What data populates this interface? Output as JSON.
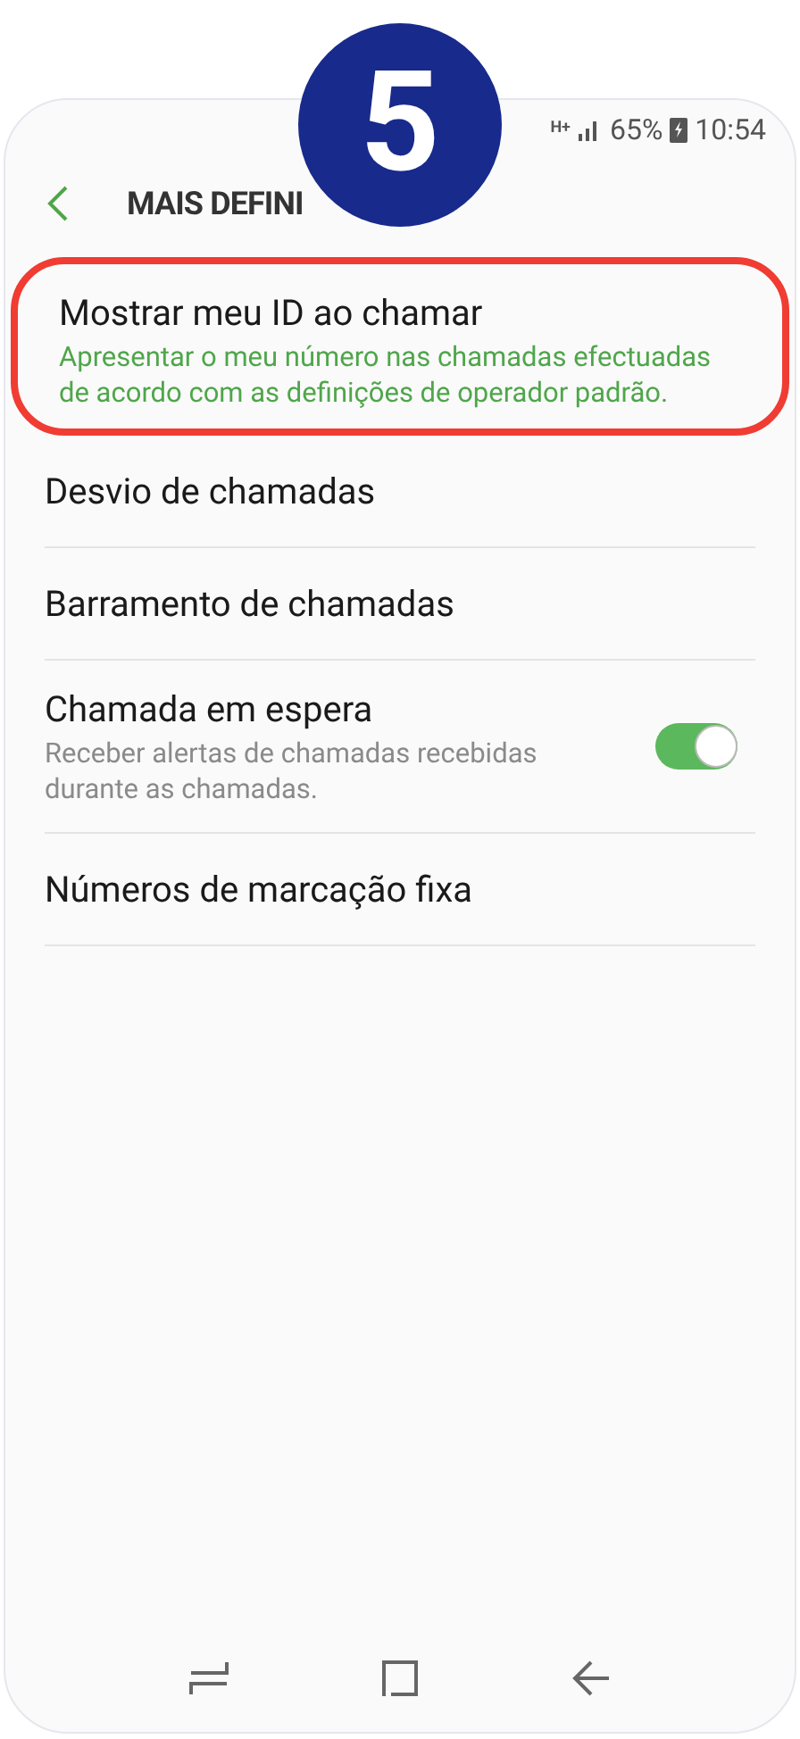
{
  "status_bar": {
    "network": "H+",
    "battery": "65%",
    "time": "10:54"
  },
  "step_badge": "5",
  "header": {
    "title": "MAIS DEFINI"
  },
  "items": [
    {
      "kind": "subtitle",
      "title": "Mostrar meu ID ao chamar",
      "subtitle": "Apresentar o meu número nas chamadas efectuadas de acordo com as definições de operador padrão.",
      "highlighted": true
    },
    {
      "kind": "plain",
      "title": "Desvio de chamadas",
      "highlighted": false
    },
    {
      "kind": "plain",
      "title": "Barramento de chamadas",
      "highlighted": false
    },
    {
      "kind": "toggle",
      "title": "Chamada em espera",
      "subtitle": "Receber alertas de chamadas recebidas durante as chamadas.",
      "on": true,
      "highlighted": false
    },
    {
      "kind": "plain",
      "title": "Números de marcação fixa",
      "highlighted": false
    }
  ]
}
